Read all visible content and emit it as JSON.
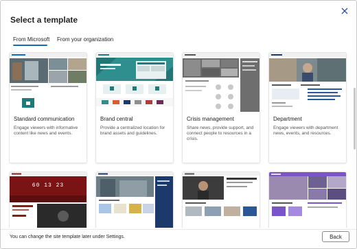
{
  "dialog": {
    "title": "Select a template",
    "close_icon": "close-icon"
  },
  "tabs": [
    {
      "label": "From Microsoft",
      "active": true
    },
    {
      "label": "From your organization",
      "active": false
    }
  ],
  "templates": [
    {
      "title": "Standard communication",
      "description": "Engage viewers with informative content like news and events."
    },
    {
      "title": "Brand central",
      "description": "Provide a centralized location for brand assets and guidelines."
    },
    {
      "title": "Crisis management",
      "description": "Share news, provide support, and connect people to resources in a crisis."
    },
    {
      "title": "Department",
      "description": "Engage viewers with department news, events, and resources."
    },
    {
      "title": "",
      "description": ""
    },
    {
      "title": "",
      "description": ""
    },
    {
      "title": "",
      "description": ""
    },
    {
      "title": "",
      "description": ""
    }
  ],
  "partial_thumb_text": {
    "event_countdown": "60 13 23"
  },
  "footer": {
    "note": "You can change the site template later under Settings.",
    "back_label": "Back"
  },
  "colors": {
    "accent": "#0f6cbd",
    "teal": "#1f7a7a",
    "red_dark": "#8b1a1a",
    "purple": "#7a55c9",
    "navy": "#1b3a6b"
  }
}
